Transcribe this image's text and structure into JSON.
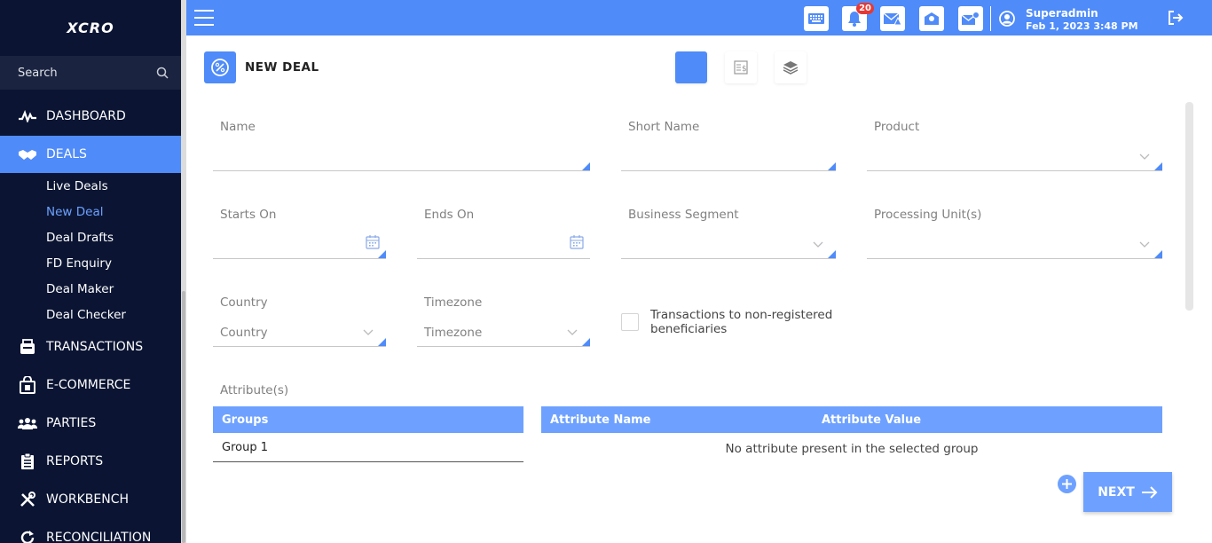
{
  "sidebar": {
    "logo": "XCRO",
    "search_label": "Search",
    "nav": [
      {
        "label": "DASHBOARD",
        "icon": "pulse-icon"
      },
      {
        "label": "DEALS",
        "icon": "handshake-icon"
      },
      {
        "label": "TRANSACTIONS",
        "icon": "transactions-icon"
      },
      {
        "label": "E-COMMERCE",
        "icon": "shopping-bag-icon"
      },
      {
        "label": "PARTIES",
        "icon": "people-icon"
      },
      {
        "label": "REPORTS",
        "icon": "clipboard-icon"
      },
      {
        "label": "WORKBENCH",
        "icon": "tools-icon"
      },
      {
        "label": "RECONCILIATION",
        "icon": "refresh-icon"
      }
    ],
    "deals_sub": [
      "Live Deals",
      "New Deal",
      "Deal Drafts",
      "FD Enquiry",
      "Deal Maker",
      "Deal Checker"
    ],
    "active_sub": "New Deal"
  },
  "topbar": {
    "notification_count": "20",
    "user_name": "Superadmin",
    "user_date": "Feb 1, 2023 3:48 PM"
  },
  "page": {
    "title": "NEW DEAL"
  },
  "form": {
    "name_label": "Name",
    "short_name_label": "Short Name",
    "product_label": "Product",
    "starts_on_label": "Starts On",
    "ends_on_label": "Ends On",
    "business_segment_label": "Business Segment",
    "processing_unit_label": "Processing Unit(s)",
    "country_label": "Country",
    "country_placeholder": "Country",
    "timezone_label": "Timezone",
    "timezone_placeholder": "Timezone",
    "checkbox_label": "Transactions to non-registered beneficiaries",
    "attributes_label": "Attribute(s)"
  },
  "groups_table": {
    "header": "Groups",
    "rows": [
      "Group 1"
    ]
  },
  "attributes_table": {
    "headers": [
      "Attribute Name",
      "Attribute Value"
    ],
    "empty_message": "No attribute present in the selected group"
  },
  "next_label": "NEXT",
  "colors": {
    "accent": "#4f8bf9",
    "sidebar": "#0b1533",
    "table_header": "#6ea1ff"
  }
}
